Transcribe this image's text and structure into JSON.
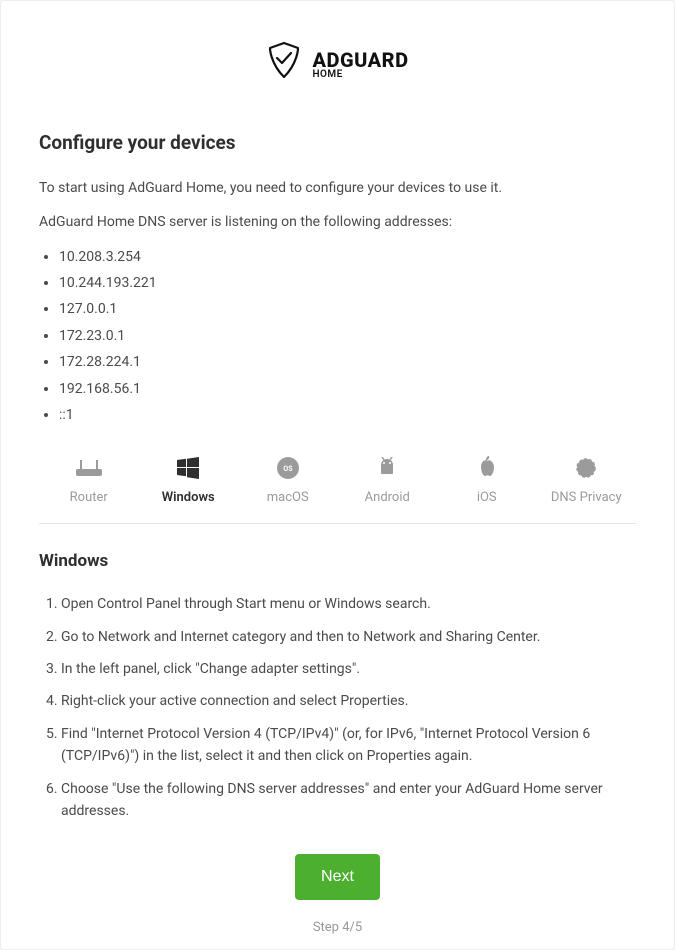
{
  "logo": {
    "brand": "ADGUARD",
    "sub": "HOME"
  },
  "title": "Configure your devices",
  "intro1": "To start using AdGuard Home, you need to configure your devices to use it.",
  "intro2": "AdGuard Home DNS server is listening on the following addresses:",
  "addresses": [
    "10.208.3.254",
    "10.244.193.221",
    "127.0.0.1",
    "172.23.0.1",
    "172.28.224.1",
    "192.168.56.1",
    "::1"
  ],
  "tabs": [
    {
      "id": "router",
      "label": "Router",
      "active": false
    },
    {
      "id": "windows",
      "label": "Windows",
      "active": true
    },
    {
      "id": "macos",
      "label": "macOS",
      "active": false
    },
    {
      "id": "android",
      "label": "Android",
      "active": false
    },
    {
      "id": "ios",
      "label": "iOS",
      "active": false
    },
    {
      "id": "dns",
      "label": "DNS Privacy",
      "active": false
    }
  ],
  "instructions": {
    "title": "Windows",
    "steps": [
      "Open Control Panel through Start menu or Windows search.",
      "Go to Network and Internet category and then to Network and Sharing Center.",
      "In the left panel, click \"Change adapter settings\".",
      "Right-click your active connection and select Properties.",
      "Find \"Internet Protocol Version 4 (TCP/IPv4)\" (or, for IPv6, \"Internet Protocol Version 6 (TCP/IPv6)\") in the list, select it and then click on Properties again.",
      "Choose \"Use the following DNS server addresses\" and enter your AdGuard Home server addresses."
    ]
  },
  "next_label": "Next",
  "step_indicator": "Step 4/5",
  "colors": {
    "accent": "#4caf2f"
  }
}
